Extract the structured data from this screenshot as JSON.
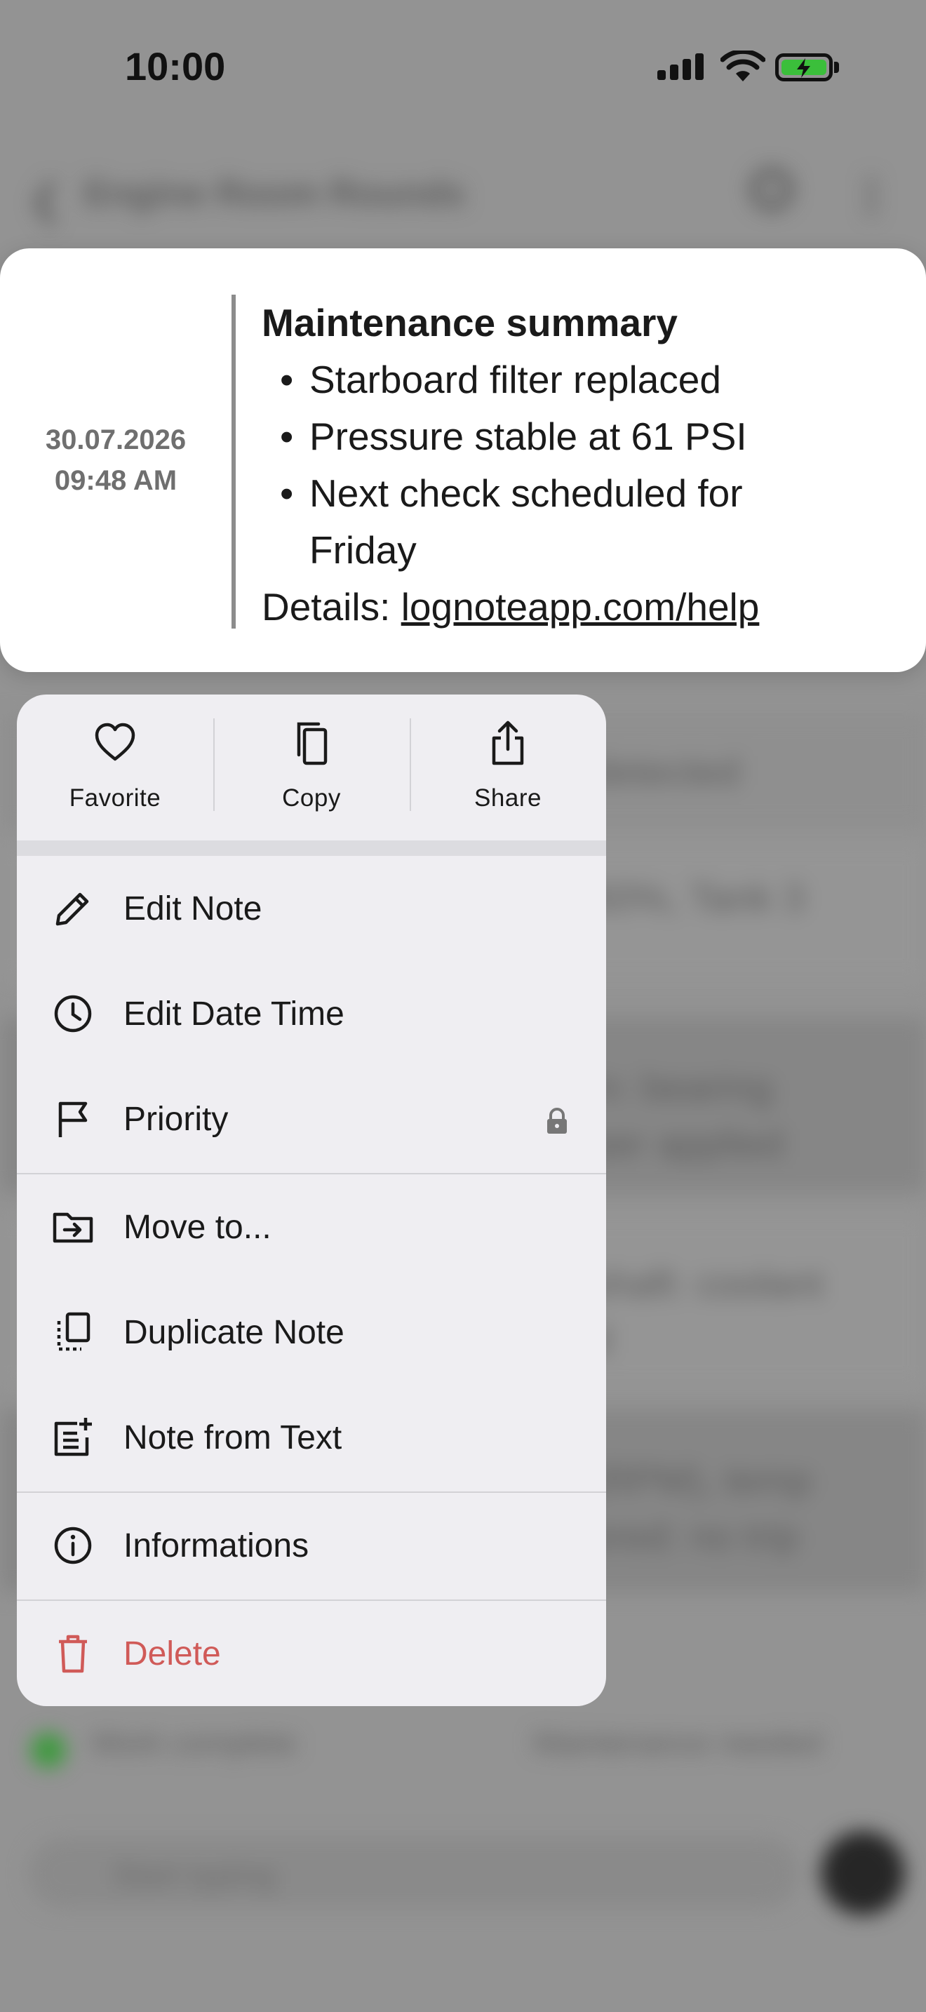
{
  "status_bar": {
    "time": "10:00"
  },
  "background": {
    "app_title": "Engine Room Rounds",
    "row_snippets": [
      "detected",
      "60%, Tank 3",
      "in: bearing",
      "per applied",
      "shaft: coolant",
      "d",
      "(RPM), temp",
      "ered: no trip"
    ],
    "tag_left": "Work complete",
    "tag_right": "Maintenance needed",
    "input_placeholder": "Start typing"
  },
  "note": {
    "date": "30.07.2026",
    "time": "09:48 AM",
    "heading": "Maintenance summary",
    "bullets": [
      "Starboard filter replaced",
      "Pressure stable at 61 PSI",
      "Next check scheduled for Friday"
    ],
    "details_label": "Details: ",
    "details_link": "lognoteapp.com/help"
  },
  "menu": {
    "quick_actions": [
      {
        "label": "Favorite",
        "icon": "heart-icon"
      },
      {
        "label": "Copy",
        "icon": "copy-icon"
      },
      {
        "label": "Share",
        "icon": "share-icon"
      }
    ],
    "items": [
      {
        "label": "Edit Note",
        "icon": "pencil-icon"
      },
      {
        "label": "Edit Date Time",
        "icon": "clock-icon"
      },
      {
        "label": "Priority",
        "icon": "flag-icon",
        "locked": true
      },
      {
        "label": "Move to...",
        "icon": "folder-move-icon"
      },
      {
        "label": "Duplicate Note",
        "icon": "duplicate-icon"
      },
      {
        "label": "Note from Text",
        "icon": "note-add-icon"
      },
      {
        "label": "Informations",
        "icon": "info-icon"
      },
      {
        "label": "Delete",
        "icon": "trash-icon",
        "danger": true
      }
    ]
  },
  "colors": {
    "danger": "#d05a58",
    "battery": "#3bbf3b",
    "menu_background": "#efeef2",
    "dim_background": "#939393"
  }
}
